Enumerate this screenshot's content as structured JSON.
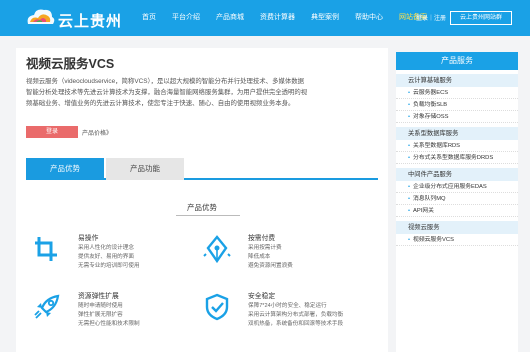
{
  "header": {
    "logo_text": "云上贵州",
    "nav": [
      "首页",
      "平台介绍",
      "产品商城",
      "资费计算器",
      "典型案例",
      "帮助中心",
      "网站备案"
    ],
    "login": "登录｜注册",
    "register_button": "云上贵州网站群",
    "colors": {
      "bg": "#1aa1e6",
      "active": "#ffe14a"
    }
  },
  "product": {
    "title": "视频云服务VCS",
    "description": "视频云服务（videocloudservice，简称VCS），是以超大规模的智能分布并行处理技术、多媒体数据智能分析处理技术等先进云计算技术为支撑，融合海量智能网络服务集群，为用户提供完全透明的视频基础业务、增值业务的先进云计算技术，使您专注于快速、随心、自由的使用视频业务本身。",
    "buy_button": "登录",
    "price_link": "产品价格》"
  },
  "tabs": [
    "产品优势",
    "产品功能"
  ],
  "section_title": "产品优势",
  "features": [
    {
      "icon": "crop-icon",
      "title": "易操作",
      "lines": [
        "采用人性化的设计理念",
        "提供友好、易用的界面",
        "无需专业的培训即可使用"
      ]
    },
    {
      "icon": "pen-nib-icon",
      "title": "按需付费",
      "lines": [
        "采用按需计费",
        "降低成本",
        "避免资源闲置浪费"
      ]
    },
    {
      "icon": "rocket-icon",
      "title": "资源弹性扩展",
      "lines": [
        "随时申请随时使用",
        "弹性扩展无限扩容",
        "无需担心性能和技术限制"
      ]
    },
    {
      "icon": "shield-check-icon",
      "title": "安全稳定",
      "lines": [
        "保障7*24小时的安全、稳定运行",
        "采用云计算架构分布式部署，负载均衡",
        "双机热备，系统备份和回滚等技术手段"
      ]
    }
  ],
  "sidebar": {
    "title": "产品服务",
    "groups": [
      {
        "label": "云计算基础服务",
        "items": [
          "云服务器ECS",
          "负载均衡SLB",
          "对象存储OSS"
        ]
      },
      {
        "label": "关系型数据库服务",
        "items": [
          "关系型数据库RDS",
          "分布式关系型数据库服务DRDS"
        ]
      },
      {
        "label": "中间件产品服务",
        "items": [
          "企业级分布式应用服务EDAS",
          "消息队列MQ",
          "API网关"
        ]
      },
      {
        "label": "视频云服务",
        "items": [
          "视频云服务VCS"
        ]
      }
    ]
  }
}
